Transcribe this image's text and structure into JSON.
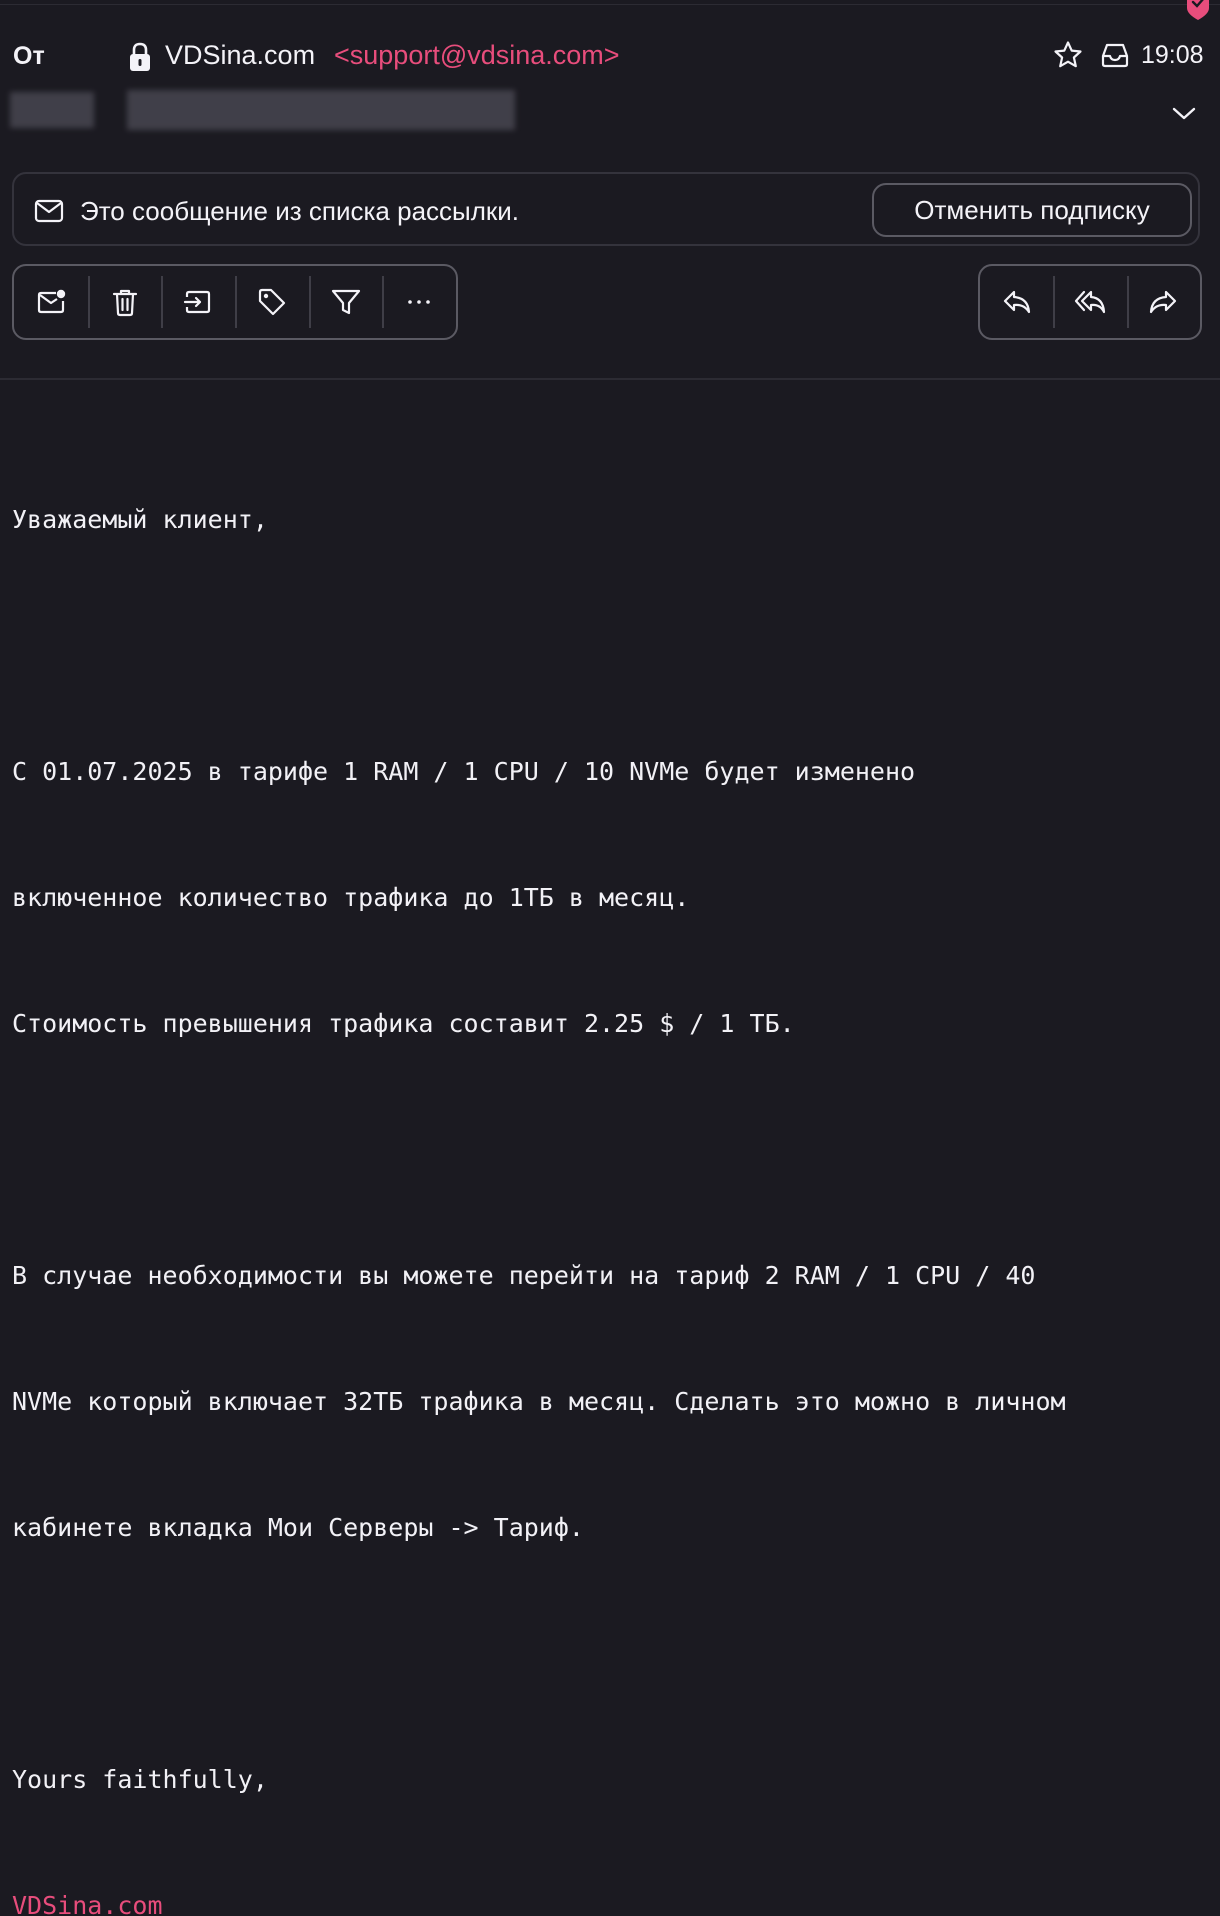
{
  "header": {
    "from_label": "От",
    "sender_name": "VDSina.com",
    "sender_email": "<support@vdsina.com>",
    "time": "19:08"
  },
  "mailing_banner": {
    "text": "Это сообщение из списка рассылки.",
    "unsubscribe_label": "Отменить подписку"
  },
  "toolbar": {
    "left_icons": [
      "mark-unread-icon",
      "trash-icon",
      "move-icon",
      "tag-icon",
      "filter-icon",
      "more-icon"
    ],
    "right_icons": [
      "reply-icon",
      "reply-all-icon",
      "forward-icon"
    ]
  },
  "body": {
    "greeting": "Уважаемый клиент,",
    "p1_l1": "С 01.07.2025 в тарифе 1 RAM / 1 CPU / 10 NVMe будет изменено",
    "p1_l2": "включенное количество трафика до 1ТБ в месяц.",
    "p1_l3": "Стоимость превышения трафика составит 2.25 $ / 1 ТБ.",
    "p2_l1": "В случае необходимости вы можете перейти на тариф 2 RAM / 1 CPU / 40",
    "p2_l2": "NVMe который включает 32ТБ трафика в месяц. Сделать это можно в личном",
    "p2_l3": "кабинете вкладка Мои Серверы -> Тариф.",
    "closing": "Yours faithfully,",
    "signature_link": "VDSina.com"
  },
  "colors": {
    "background": "#1b1a21",
    "accent": "#e84d7c",
    "text": "#f2f1f6",
    "border": "#5b5a63"
  }
}
